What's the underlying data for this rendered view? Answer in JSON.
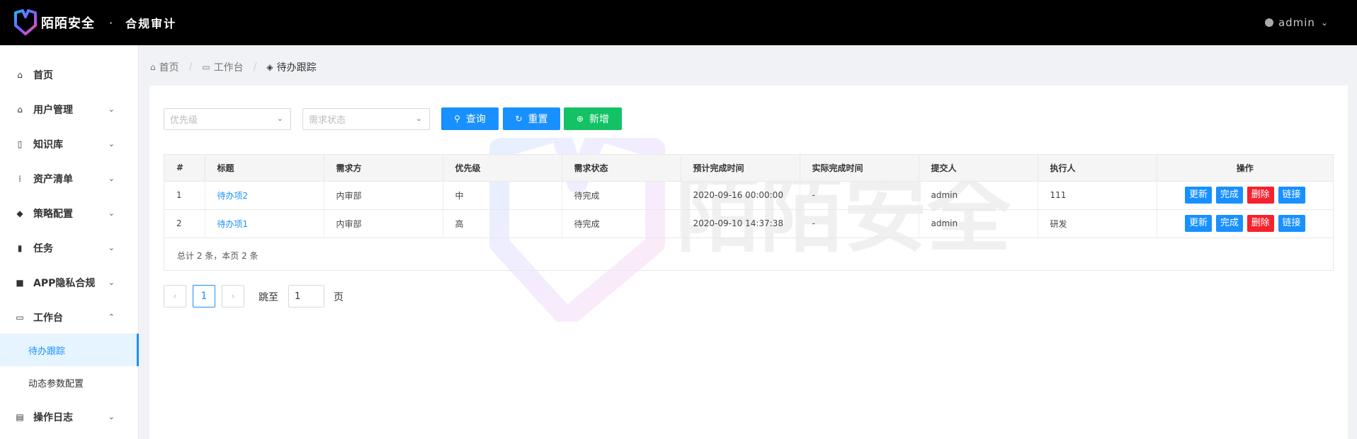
{
  "header": {
    "brand": "陌陌安全",
    "separator": "·",
    "app_name": "合规审计",
    "user": "admin"
  },
  "sidebar": {
    "items": [
      {
        "label": "首页",
        "icon": "home-icon"
      },
      {
        "label": "用户管理",
        "icon": "home-icon"
      },
      {
        "label": "知识库",
        "icon": "book-icon"
      },
      {
        "label": "资产清单",
        "icon": "grid-icon"
      },
      {
        "label": "策略配置",
        "icon": "box-icon"
      },
      {
        "label": "任务",
        "icon": "bar-chart-icon"
      },
      {
        "label": "APP隐私合规",
        "icon": "briefcase-icon"
      },
      {
        "label": "工作台",
        "icon": "desktop-icon"
      },
      {
        "label": "操作日志",
        "icon": "log-icon"
      }
    ],
    "sub_items": [
      {
        "label": "待办跟踪",
        "active": true
      },
      {
        "label": "动态参数配置",
        "active": false
      }
    ]
  },
  "breadcrumb": {
    "home": "首页",
    "workbench": "工作台",
    "current": "待办跟踪"
  },
  "filters": {
    "priority_placeholder": "优先级",
    "status_placeholder": "需求状态"
  },
  "buttons": {
    "query": "查询",
    "reset": "重置",
    "add": "新增"
  },
  "table": {
    "columns": [
      "#",
      "标题",
      "需求方",
      "优先级",
      "需求状态",
      "预计完成时间",
      "实际完成时间",
      "提交人",
      "执行人",
      "操作"
    ],
    "rows": [
      {
        "no": "1",
        "title": "待办项2",
        "requester": "内审部",
        "priority": "中",
        "status": "待完成",
        "expected": "2020-09-16 00:00:00",
        "actual": "-",
        "submitter": "admin",
        "executor": "111"
      },
      {
        "no": "2",
        "title": "待办项1",
        "requester": "内审部",
        "priority": "高",
        "status": "待完成",
        "expected": "2020-09-10 14:37:38",
        "actual": "-",
        "submitter": "admin",
        "executor": "研发"
      }
    ],
    "actions": {
      "update": "更新",
      "complete": "完成",
      "delete": "删除",
      "link": "链接"
    },
    "total_text": "总计 2 条，本页 2 条"
  },
  "pagination": {
    "prev": "‹",
    "current": "1",
    "next": "›",
    "jump_to": "跳至",
    "jump_value": "1",
    "page": "页"
  },
  "watermark": "陌陌安全",
  "colors": {
    "primary": "#1890ff",
    "success": "#13c265",
    "danger": "#f5222d",
    "header_bg": "#000000"
  }
}
